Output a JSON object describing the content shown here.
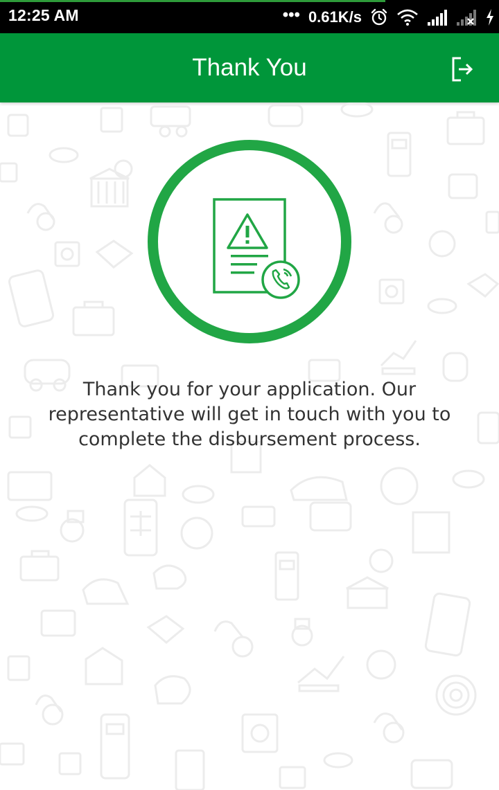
{
  "status_bar": {
    "time": "12:25 AM",
    "dots": "•••",
    "net_speed": "0.61K/s",
    "icons": [
      "alarm-icon",
      "wifi-icon",
      "signal-icon",
      "signal-no-service-icon",
      "charging-icon"
    ]
  },
  "app_bar": {
    "title": "Thank You",
    "action_icon": "logout-icon"
  },
  "hero": {
    "icon": "document-warning-call-icon"
  },
  "message": {
    "text": "Thank you for your application. Our representative will get in touch with you to complete the disbursement process."
  },
  "colors": {
    "primary": "#00963a",
    "ring": "#21a645",
    "text": "#333333",
    "pattern": "#efefef"
  }
}
